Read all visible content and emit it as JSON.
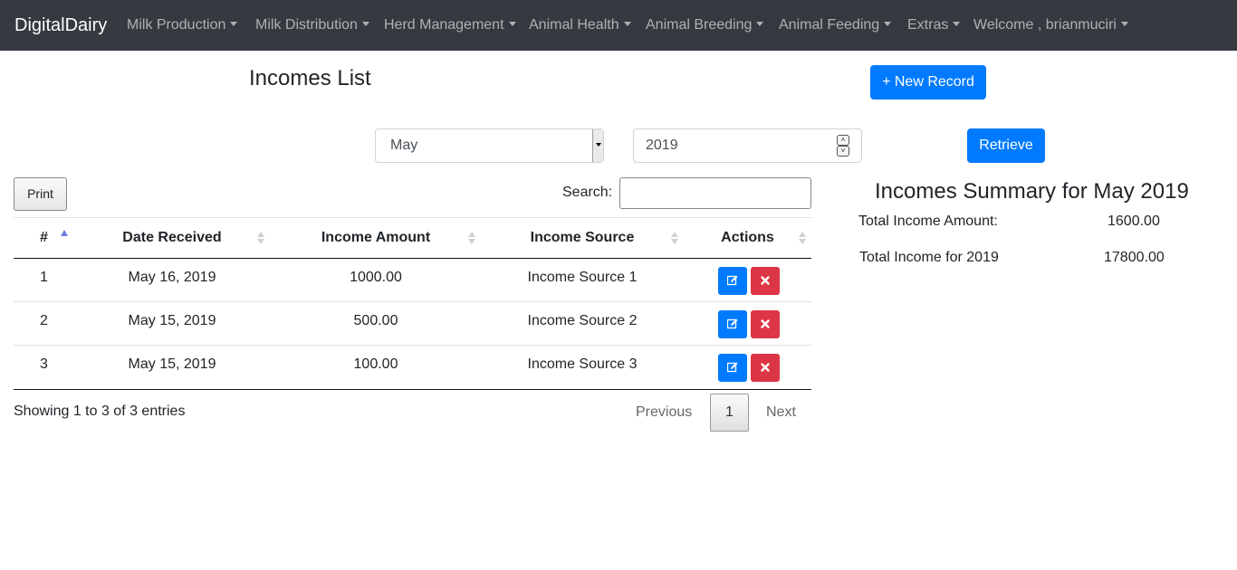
{
  "navbar": {
    "brand": "DigitalDairy",
    "items": [
      {
        "label": "Milk Production"
      },
      {
        "label": "Milk Distribution"
      },
      {
        "label": "Herd Management"
      },
      {
        "label": "Animal Health"
      },
      {
        "label": "Animal Breeding"
      },
      {
        "label": "Animal Feeding"
      },
      {
        "label": "Extras"
      },
      {
        "label": "Welcome , brianmuciri"
      }
    ],
    "background": "#343a40"
  },
  "page": {
    "title": "Incomes List",
    "new_record_label": "+ New Record"
  },
  "filters": {
    "month": "May",
    "year": "2019",
    "retrieve_label": "Retrieve"
  },
  "table_tools": {
    "print_label": "Print",
    "search_label": "Search:",
    "search_value": ""
  },
  "table": {
    "headers": [
      "#",
      "Date Received",
      "Income Amount",
      "Income Source",
      "Actions"
    ],
    "rows": [
      {
        "num": "1",
        "date": "May 16, 2019",
        "amount": "1000.00",
        "source": "Income Source 1"
      },
      {
        "num": "2",
        "date": "May 15, 2019",
        "amount": "500.00",
        "source": "Income Source 2"
      },
      {
        "num": "3",
        "date": "May 15, 2019",
        "amount": "100.00",
        "source": "Income Source 3"
      }
    ],
    "info": "Showing 1 to 3 of 3 entries",
    "pagination": {
      "previous": "Previous",
      "current": "1",
      "next": "Next"
    }
  },
  "summary": {
    "title": "Incomes Summary for May 2019",
    "total_amount_label": "Total Income Amount:",
    "total_amount_value": "1600.00",
    "total_year_label": "Total Income for 2019",
    "total_year_value": "17800.00"
  },
  "colors": {
    "primary": "#007bff",
    "danger": "#dc3545",
    "sort_active": "#6f7bd9"
  },
  "icons": {
    "edit": "edit-icon",
    "delete": "close-icon",
    "dropdown": "caret-down-icon",
    "sort": "sort-icon"
  }
}
